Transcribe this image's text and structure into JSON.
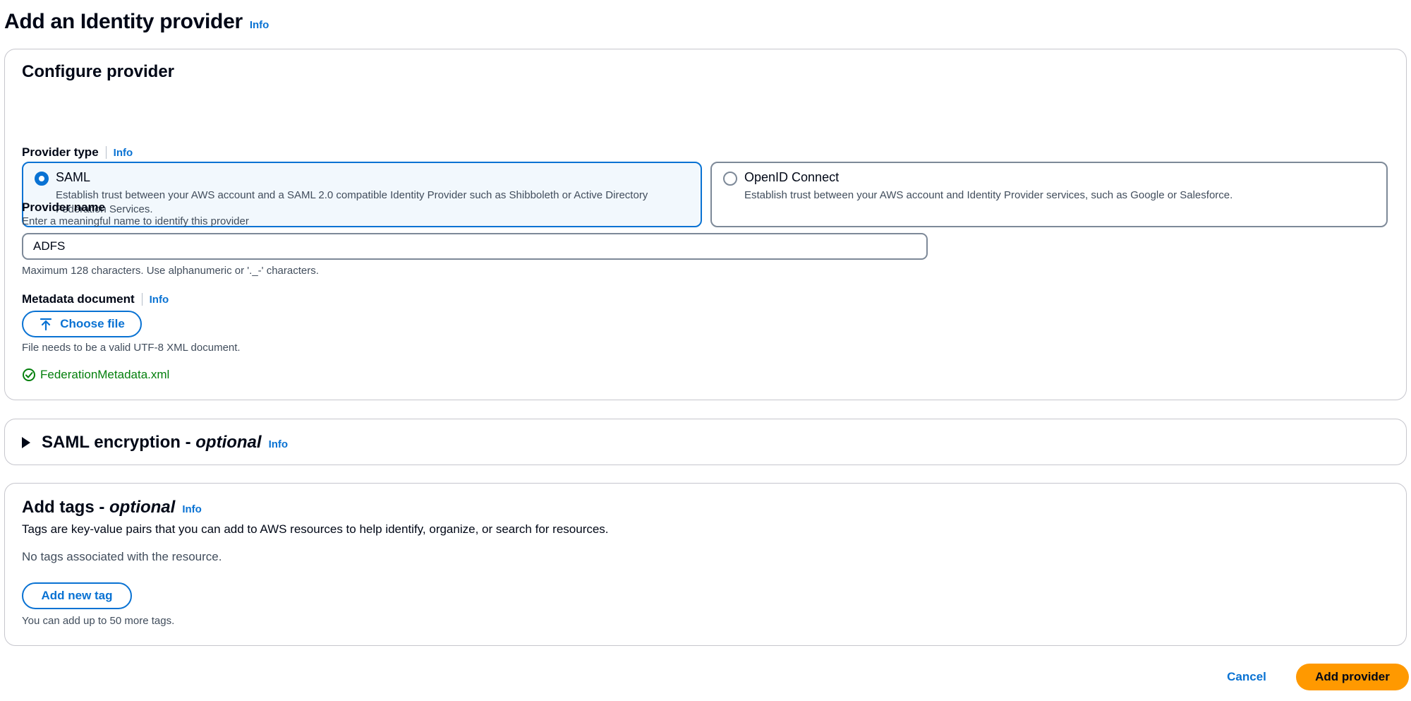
{
  "page": {
    "title": "Add an Identity provider",
    "info": "Info"
  },
  "configure": {
    "title": "Configure provider",
    "provider_type": {
      "label": "Provider type",
      "info": "Info",
      "options": [
        {
          "title": "SAML",
          "description": "Establish trust between your AWS account and a SAML 2.0 compatible Identity Provider such as Shibboleth or Active Directory Federation Services.",
          "selected": true
        },
        {
          "title": "OpenID Connect",
          "description": "Establish trust between your AWS account and Identity Provider services, such as Google or Salesforce.",
          "selected": false
        }
      ]
    },
    "provider_name": {
      "label": "Provider name",
      "description": "Enter a meaningful name to identify this provider",
      "value": "ADFS",
      "constraint": "Maximum 128 characters. Use alphanumeric or '._-' characters."
    },
    "metadata": {
      "label": "Metadata document",
      "info": "Info",
      "button_label": "Choose file",
      "constraint": "File needs to be a valid UTF-8 XML document.",
      "file_name": "FederationMetadata.xml"
    }
  },
  "encryption": {
    "title": "SAML encryption - ",
    "optional": "optional",
    "info": "Info"
  },
  "tags": {
    "title": "Add tags - ",
    "optional": "optional",
    "info": "Info",
    "description": "Tags are key-value pairs that you can add to AWS resources to help identify, organize, or search for resources.",
    "empty": "No tags associated with the resource.",
    "add_label": "Add new tag",
    "limit": "You can add up to 50 more tags."
  },
  "footer": {
    "cancel_label": "Cancel",
    "submit_label": "Add provider"
  },
  "colors": {
    "link": "#0972d3",
    "primary_button": "#ff9900",
    "success": "#037f0c"
  },
  "icons": {
    "upload": "upload-icon",
    "success": "status-positive-icon",
    "expand": "caret-right-icon"
  }
}
